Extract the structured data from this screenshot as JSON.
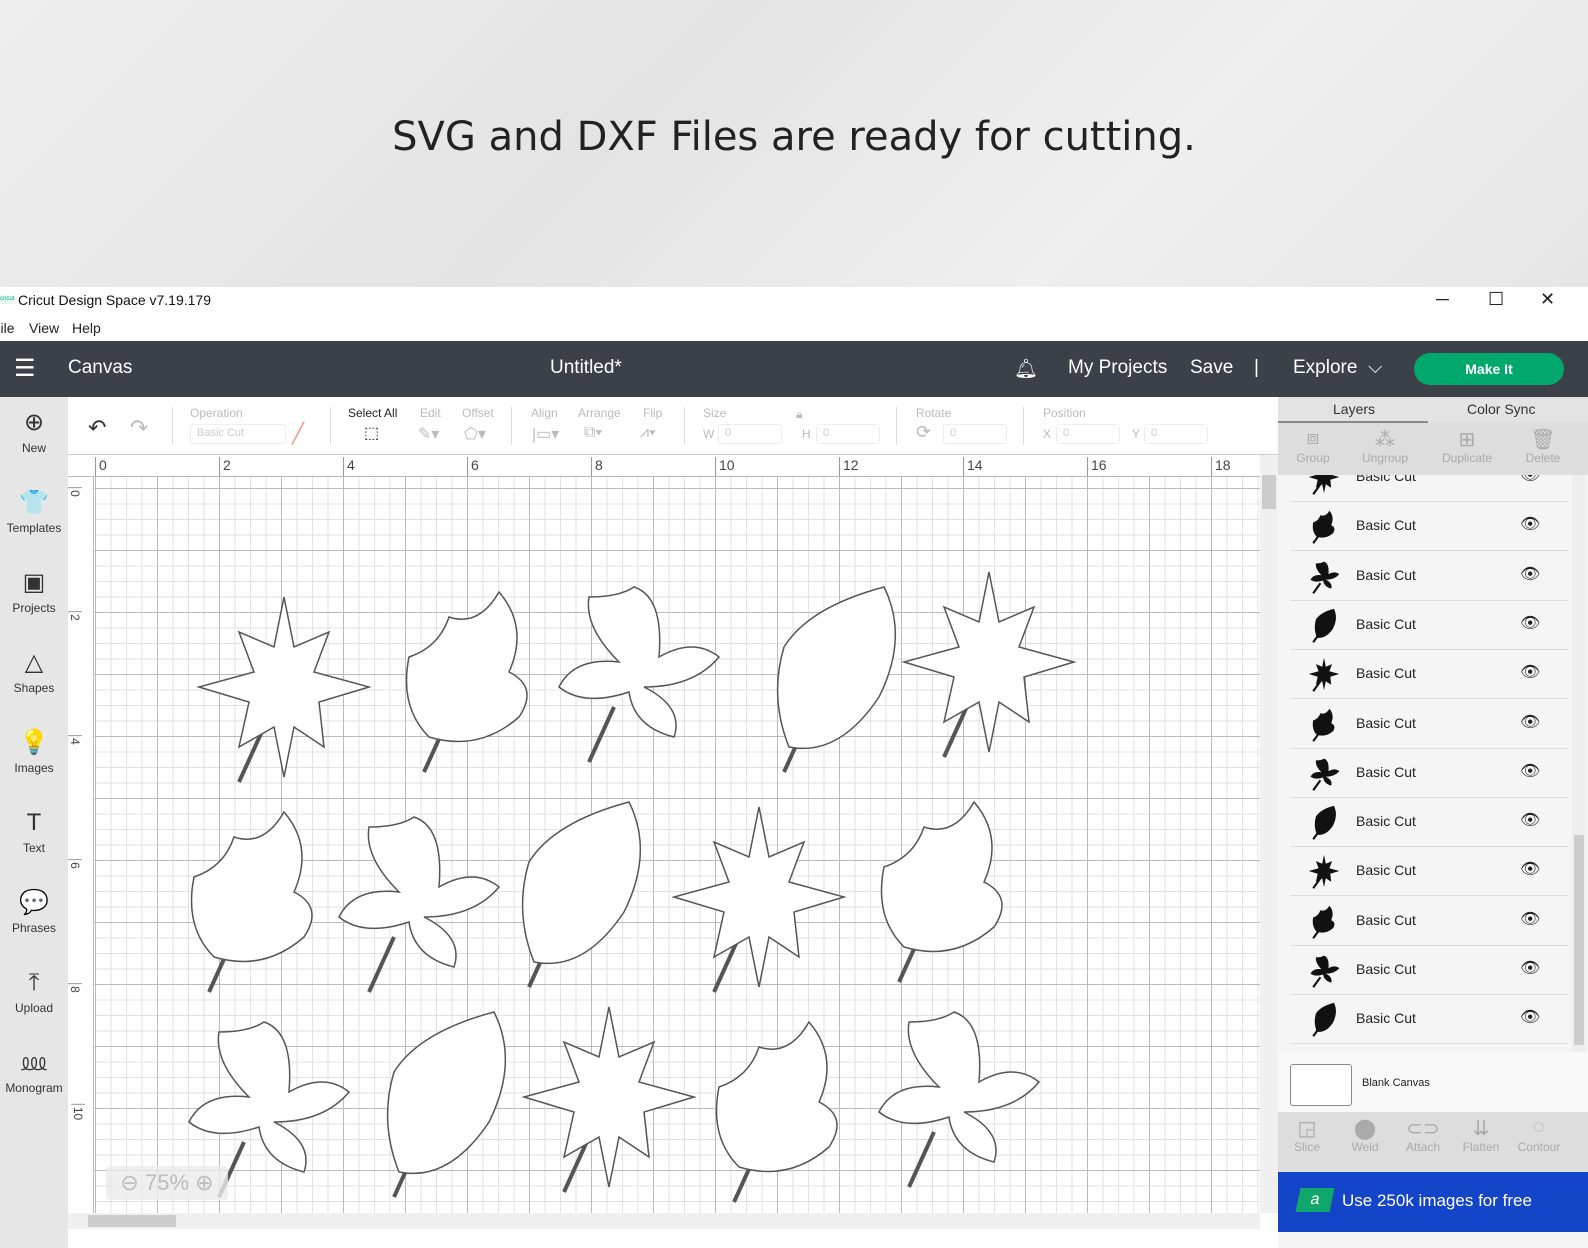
{
  "banner": {
    "text": "SVG and DXF Files are ready for cutting."
  },
  "window": {
    "logo": "cricut",
    "title": "Cricut Design Space  v7.19.179",
    "minimize": "─",
    "maximize": "☐",
    "close": "✕"
  },
  "menu": [
    "File",
    "View",
    "Help"
  ],
  "header": {
    "section": "Canvas",
    "doc_title": "Untitled*",
    "my_projects": "My Projects",
    "save": "Save",
    "divider": "|",
    "explore": "Explore",
    "make_it": "Make It"
  },
  "sidebar": [
    {
      "label": "New",
      "icon": "⊕"
    },
    {
      "label": "Templates",
      "icon": "👕"
    },
    {
      "label": "Projects",
      "icon": "▣"
    },
    {
      "label": "Shapes",
      "icon": "△"
    },
    {
      "label": "Images",
      "icon": "💡"
    },
    {
      "label": "Text",
      "icon": "T"
    },
    {
      "label": "Phrases",
      "icon": "💬"
    },
    {
      "label": "Upload",
      "icon": "⤒"
    },
    {
      "label": "Monogram",
      "icon": "⅏"
    }
  ],
  "toolbar": {
    "operation_label": "Operation",
    "operation_value": "Basic Cut",
    "select_all": "Select All",
    "edit": "Edit",
    "offset": "Offset",
    "align": "Align",
    "arrange": "Arrange",
    "flip": "Flip",
    "size": "Size",
    "w": "W",
    "h": "H",
    "w_value": "0",
    "h_value": "0",
    "rotate": "Rotate",
    "rotate_value": "0",
    "position": "Position",
    "x": "X",
    "y": "Y",
    "x_value": "0",
    "y_value": "0"
  },
  "ruler": {
    "top": [
      "0",
      "2",
      "4",
      "6",
      "8",
      "10",
      "12",
      "14",
      "16",
      "18"
    ],
    "left": [
      "0",
      "2",
      "4",
      "6",
      "8",
      "10"
    ]
  },
  "zoom": {
    "level": "75%",
    "minus": "⊖",
    "plus": "⊕"
  },
  "panel": {
    "tabs": [
      "Layers",
      "Color Sync"
    ],
    "tools": [
      "Group",
      "Ungroup",
      "Duplicate",
      "Delete"
    ],
    "layers": [
      "Basic Cut",
      "Basic Cut",
      "Basic Cut",
      "Basic Cut",
      "Basic Cut",
      "Basic Cut",
      "Basic Cut",
      "Basic Cut",
      "Basic Cut",
      "Basic Cut",
      "Basic Cut",
      "Basic Cut"
    ],
    "blank_canvas": "Blank Canvas",
    "bottom_tools": [
      "Slice",
      "Weld",
      "Attach",
      "Flatten",
      "Contour"
    ],
    "promo_badge": "a",
    "promo": "Use 250k images for free"
  },
  "colors": {
    "header": "#3c4048",
    "make_it": "#00a86b",
    "promo": "#1444c8"
  }
}
